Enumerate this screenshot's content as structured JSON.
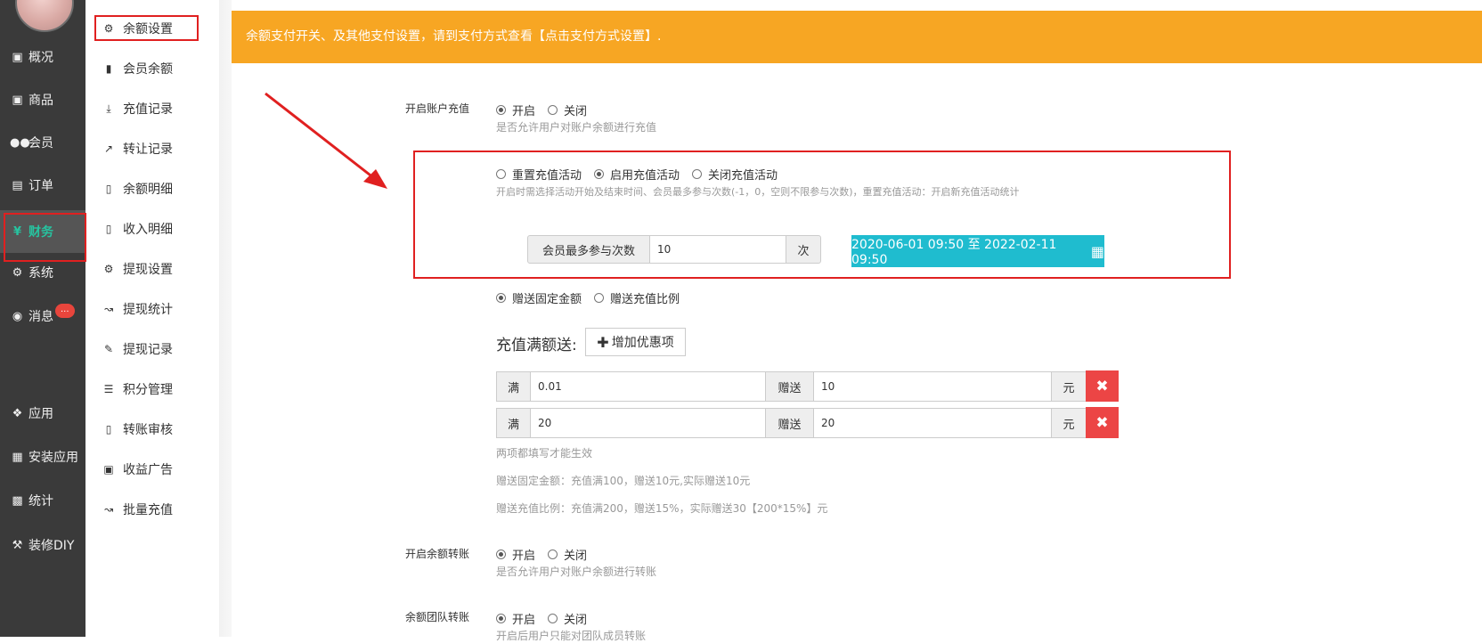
{
  "nav": {
    "items": [
      {
        "label": "概况",
        "icon": "window-icon"
      },
      {
        "label": "商品",
        "icon": "window-icon"
      },
      {
        "label": "会员",
        "icon": "users-icon"
      },
      {
        "label": "订单",
        "icon": "cart-icon"
      },
      {
        "label": "财务",
        "icon": "yen-icon"
      },
      {
        "label": "系统",
        "icon": "gears-icon"
      },
      {
        "label": "消息",
        "icon": "comment-icon"
      },
      {
        "label": "应用",
        "icon": "cubes-icon"
      },
      {
        "label": "安装应用",
        "icon": "puzzle-icon"
      },
      {
        "label": "统计",
        "icon": "bar-chart-icon"
      },
      {
        "label": "装修DIY",
        "icon": "gavel-icon"
      }
    ],
    "badge": "...",
    "active_color": "#27c3a0"
  },
  "submenu": {
    "items": [
      {
        "label": "余额设置",
        "icon": "gear-icon"
      },
      {
        "label": "会员余额",
        "icon": "book-icon"
      },
      {
        "label": "充值记录",
        "icon": "download-icon"
      },
      {
        "label": "转让记录",
        "icon": "external-link-icon"
      },
      {
        "label": "余额明细",
        "icon": "file-icon"
      },
      {
        "label": "收入明细",
        "icon": "file-icon"
      },
      {
        "label": "提现设置",
        "icon": "gear-icon"
      },
      {
        "label": "提现统计",
        "icon": "line-chart-icon"
      },
      {
        "label": "提现记录",
        "icon": "pencil-icon"
      },
      {
        "label": "积分管理",
        "icon": "database-icon"
      },
      {
        "label": "转账审核",
        "icon": "file-icon"
      },
      {
        "label": "收益广告",
        "icon": "image-icon"
      },
      {
        "label": "批量充值",
        "icon": "line-chart-icon"
      }
    ]
  },
  "notice": {
    "text": "余额支付开关、及其他支付设置，请到支付方式查看【点击支付方式设置】.",
    "color": "#f7a623"
  },
  "recharge": {
    "label": "开启账户充值",
    "options": [
      "开启",
      "关闭"
    ],
    "help": "是否允许用户对账户余额进行充值"
  },
  "activity": {
    "options": [
      "重置充值活动",
      "启用充值活动",
      "关闭充值活动"
    ],
    "help": "开启时需选择活动开始及结束时间、会员最多参与次数(-1，0，空则不限参与次数)，重置充值活动：开启新充值活动统计",
    "max_label": "会员最多参与次数",
    "max_value": "10",
    "max_unit": "次",
    "date_range": "2020-06-01 09:50 至 2022-02-11 09:50",
    "date_color": "#1fbccf"
  },
  "gift": {
    "options": [
      "赠送固定金额",
      "赠送充值比例"
    ],
    "title": "充值满额送:",
    "add_button": "增加优惠项",
    "rows": [
      {
        "full_label": "满",
        "full_value": "0.01",
        "gift_label": "赠送",
        "gift_value": "10",
        "unit": "元"
      },
      {
        "full_label": "满",
        "full_value": "20",
        "gift_label": "赠送",
        "gift_value": "20",
        "unit": "元"
      }
    ],
    "help1": "两项都填写才能生效",
    "help2": "赠送固定金额：充值满100，赠送10元,实际赠送10元",
    "help3": "赠送充值比例：充值满200，赠送15%，实际赠送30【200*15%】元",
    "delete_color": "#ec4545"
  },
  "transfer": {
    "label": "开启余额转账",
    "options": [
      "开启",
      "关闭"
    ],
    "help": "是否允许用户对账户余额进行转账"
  },
  "team": {
    "label": "余额团队转账",
    "options": [
      "开启",
      "关闭"
    ],
    "help": "开启后用户只能对团队成员转账"
  },
  "highlight_color": "#e02020"
}
